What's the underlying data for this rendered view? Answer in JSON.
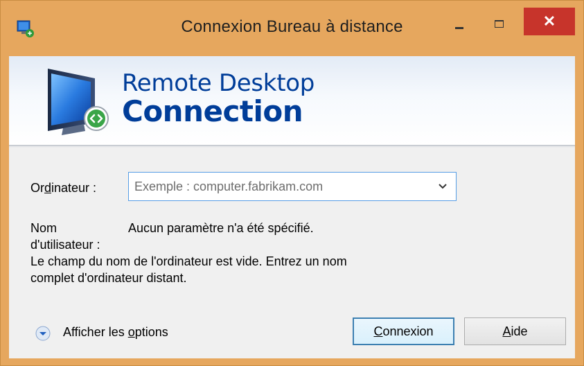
{
  "window": {
    "title": "Connexion Bureau à distance",
    "close_glyph": "✕",
    "accent_color": "#e6a75e",
    "close_color": "#c7342b"
  },
  "banner": {
    "line1": "Remote Desktop",
    "line2": "Connection",
    "icon": "remote-desktop-monitor-icon"
  },
  "form": {
    "computer_label_before": "Or",
    "computer_label_mnemonic": "d",
    "computer_label_after": "inateur :",
    "computer_placeholder": "Exemple : computer.fabrikam.com",
    "computer_value": "",
    "username_label_line1": "Nom",
    "username_label_line2": "d'utilisateur :",
    "username_value": "Aucun paramètre n'a été spécifié.",
    "error_line1": "Le champ du nom de l'ordinateur est vide. Entrez un nom",
    "error_line2": "complet d'ordinateur distant."
  },
  "footer": {
    "options_label_before": "Afficher les ",
    "options_label_mnemonic": "o",
    "options_label_after": "ptions",
    "connect_mnemonic": "C",
    "connect_rest": "onnexion",
    "help_mnemonic": "A",
    "help_rest": "ide"
  }
}
